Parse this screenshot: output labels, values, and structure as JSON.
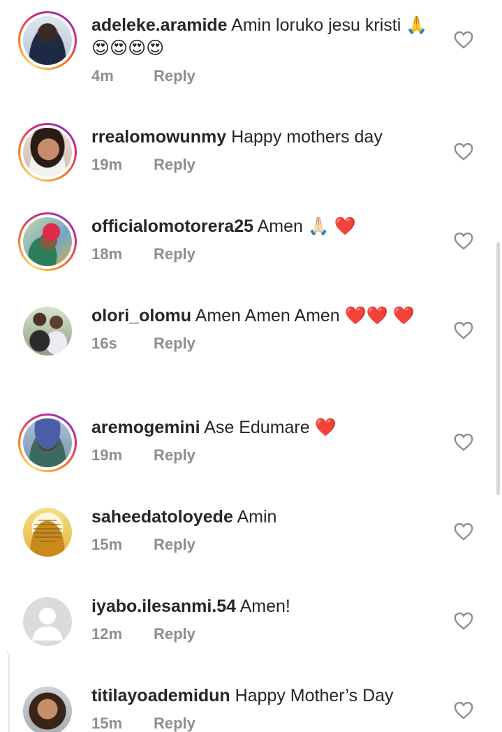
{
  "comments": [
    {
      "username": "adeleke.aramide",
      "text": "Amin loruko jesu kristi 🙏😍😍😍😍",
      "time": "4m",
      "reply": "Reply",
      "avatar": "person-photo",
      "story_ring": true
    },
    {
      "username": "rrealomowunmy",
      "text": "Happy mothers day",
      "time": "19m",
      "reply": "Reply",
      "avatar": "person-photo",
      "story_ring": true
    },
    {
      "username": "officialomotorera25",
      "text": "Amen 🙏🏻 ❤️",
      "time": "18m",
      "reply": "Reply",
      "avatar": "person-photo",
      "story_ring": true
    },
    {
      "username": "olori_olomu",
      "text": "Amen Amen Amen ❤️❤️ ❤️",
      "time": "16s",
      "reply": "Reply",
      "avatar": "couple-photo",
      "story_ring": false
    },
    {
      "username": "aremogemini",
      "text": "Ase Edumare ❤️",
      "time": "19m",
      "reply": "Reply",
      "avatar": "person-photo",
      "story_ring": true
    },
    {
      "username": "saheedatoloyede",
      "text": "Amin",
      "time": "15m",
      "reply": "Reply",
      "avatar": "quote-image",
      "story_ring": false
    },
    {
      "username": "iyabo.ilesanmi.54",
      "text": "Amen!",
      "time": "12m",
      "reply": "Reply",
      "avatar": "default-avatar",
      "story_ring": false
    },
    {
      "username": "titilayoademidun",
      "text": "Happy Mother’s Day",
      "time": "15m",
      "reply": "Reply",
      "avatar": "person-photo",
      "story_ring": false
    }
  ],
  "colors": {
    "text": "#262626",
    "meta": "#8e8e8e",
    "heart_outline": "#8e8e8e",
    "ring_start": "#feda75",
    "ring_end": "#962fbf"
  }
}
